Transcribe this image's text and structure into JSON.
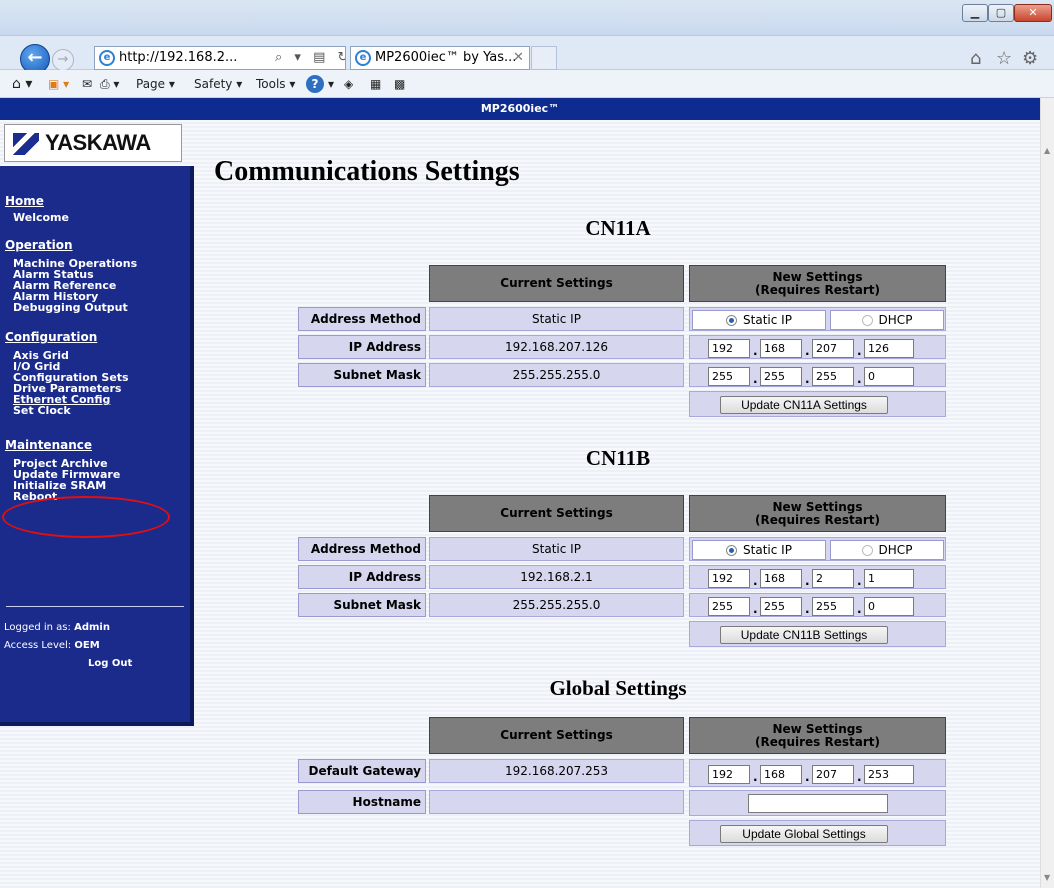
{
  "browser": {
    "address": "http://192.168.2...",
    "address_controls": "⌕ ▾ ▤ ↻ ✕",
    "tab_title": "MP2600iec™ by Yas...",
    "tab_close": "✕",
    "menu": {
      "page": "Page ▾",
      "safety": "Safety ▾",
      "tools": "Tools ▾",
      "help": "?"
    }
  },
  "app": {
    "banner": "MP2600iec™",
    "logo": "YASKAWA"
  },
  "sidebar": {
    "home_header": "Home",
    "home_items": [
      "Welcome"
    ],
    "operation_header": "Operation",
    "operation_items": [
      "Machine Operations",
      "Alarm Status",
      "Alarm Reference",
      "Alarm History",
      "Debugging Output"
    ],
    "configuration_header": "Configuration",
    "configuration_items": [
      "Axis Grid",
      "I/O Grid",
      "Configuration Sets",
      "Drive Parameters",
      "Ethernet Config",
      "Set Clock"
    ],
    "maintenance_header": "Maintenance",
    "maintenance_items": [
      "Project Archive",
      "Update Firmware",
      "Initialize SRAM",
      "Reboot"
    ],
    "logged_in_label": "Logged in as:",
    "logged_in_user": "Admin",
    "access_label": "Access Level:",
    "access_level": "OEM",
    "logout": "Log Out"
  },
  "main": {
    "title": "Communications Settings",
    "col_current": "Current Settings",
    "col_new_1": "New Settings",
    "col_new_2": "(Requires Restart)",
    "static_ip_option": "Static IP",
    "dhcp_option": "DHCP",
    "cn11a": {
      "title": "CN11A",
      "labels": [
        "Address Method",
        "IP Address",
        "Subnet Mask"
      ],
      "current": [
        "Static IP",
        "192.168.207.126",
        "255.255.255.0"
      ],
      "ip": [
        "192",
        "168",
        "207",
        "126"
      ],
      "mask": [
        "255",
        "255",
        "255",
        "0"
      ],
      "button": "Update CN11A Settings"
    },
    "cn11b": {
      "title": "CN11B",
      "labels": [
        "Address Method",
        "IP Address",
        "Subnet Mask"
      ],
      "current": [
        "Static IP",
        "192.168.2.1",
        "255.255.255.0"
      ],
      "ip": [
        "192",
        "168",
        "2",
        "1"
      ],
      "mask": [
        "255",
        "255",
        "255",
        "0"
      ],
      "button": "Update CN11B Settings"
    },
    "global": {
      "title": "Global Settings",
      "labels": [
        "Default Gateway",
        "Hostname"
      ],
      "current": [
        "192.168.207.253",
        ""
      ],
      "gateway": [
        "192",
        "168",
        "207",
        "253"
      ],
      "hostname": "",
      "button": "Update Global Settings"
    }
  }
}
